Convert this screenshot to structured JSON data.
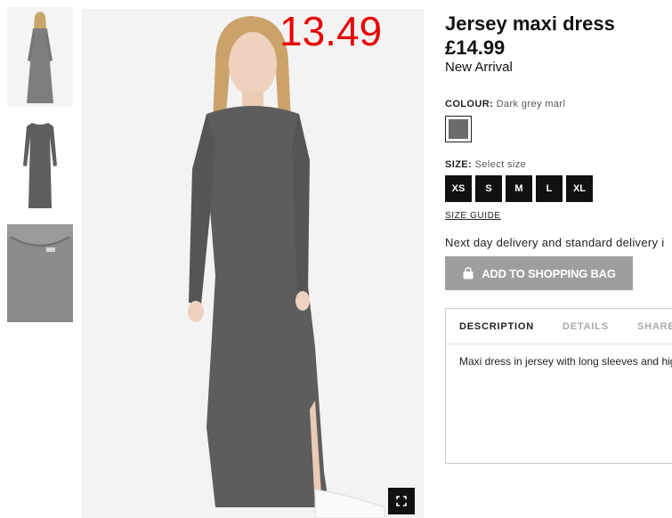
{
  "product": {
    "title": "Jersey maxi dress",
    "price": "£14.99",
    "badge": "New Arrival",
    "overlay_price": "13.49"
  },
  "colour": {
    "label": "COLOUR:",
    "value": "Dark grey marl",
    "swatch_hex": "#6b6b6b"
  },
  "size": {
    "label": "SIZE:",
    "placeholder": "Select size",
    "options": [
      "XS",
      "S",
      "M",
      "L",
      "XL"
    ],
    "guide": "SIZE GUIDE"
  },
  "delivery": "Next day delivery and standard delivery i",
  "cart": {
    "add_label": "ADD TO SHOPPING BAG",
    "button_color": "#9e9e9e"
  },
  "tabs": {
    "description": "DESCRIPTION",
    "details": "DETAILS",
    "share": "SHARE"
  },
  "description_text": "Maxi dress in jersey with long sleeves and hig",
  "icons": {
    "bag": "shopping-bag-icon",
    "fullscreen": "fullscreen-icon"
  },
  "colors": {
    "overlay_price": "#e60000",
    "size_button": "#111111"
  }
}
